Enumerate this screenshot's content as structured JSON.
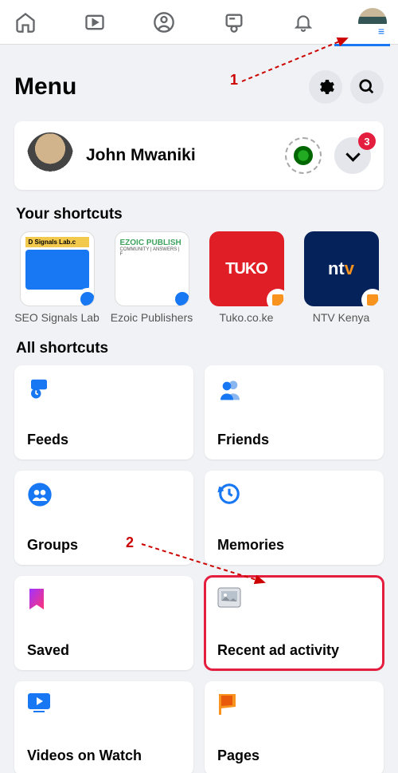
{
  "header": {
    "title": "Menu"
  },
  "profile": {
    "name": "John Mwaniki",
    "badge": "3"
  },
  "sections": {
    "your_shortcuts": "Your shortcuts",
    "all_shortcuts": "All shortcuts"
  },
  "shortcuts": [
    {
      "label": "SEO Signals Lab",
      "brand": "D Signals Lab.c"
    },
    {
      "label": "Ezoic Publishers",
      "brand": "EZOIC PUBLISH"
    },
    {
      "label": "Tuko.co.ke",
      "brand": "TUKO"
    },
    {
      "label": "NTV Kenya",
      "brand": "ntv"
    }
  ],
  "tiles": [
    {
      "label": "Feeds"
    },
    {
      "label": "Friends"
    },
    {
      "label": "Groups"
    },
    {
      "label": "Memories"
    },
    {
      "label": "Saved"
    },
    {
      "label": "Recent ad activity"
    },
    {
      "label": "Videos on Watch"
    },
    {
      "label": "Pages"
    }
  ],
  "annotations": {
    "one": "1",
    "two": "2"
  }
}
